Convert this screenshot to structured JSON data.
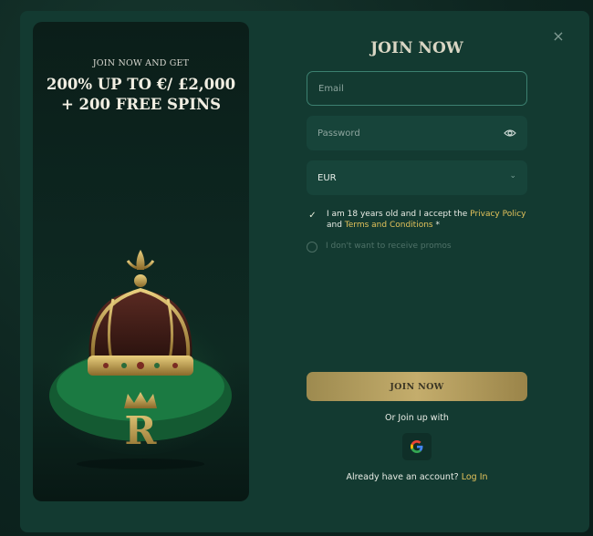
{
  "promo": {
    "kicker": "JOIN NOW AND GET",
    "headline": "200% UP TO €/ £2,000 + 200 FREE SPINS",
    "logo_letter": "R"
  },
  "form": {
    "title": "JOIN NOW",
    "email_placeholder": "Email",
    "password_placeholder": "Password",
    "currency_value": "EUR",
    "terms_prefix": "I am 18 years old and I accept the ",
    "privacy_link": "Privacy Policy",
    "terms_and": " and ",
    "terms_link": "Terms and Conditions",
    "terms_suffix": " *",
    "terms_checked": true,
    "promos_label": "I don't want to receive promos",
    "promos_checked": false,
    "submit_label": "JOIN NOW",
    "or_join": "Or Join up with",
    "have_account": "Already have an account? ",
    "login_link": "Log In"
  },
  "icons": {
    "close": "close-icon",
    "eye": "eye-icon",
    "chevron": "chevron-down-icon",
    "check": "checkmark-icon",
    "google": "google-icon"
  },
  "colors": {
    "background": "#133a31",
    "accent_gold": "#e3c25b",
    "button_gold": "#c4ad6c",
    "field_bg": "#17443a"
  }
}
